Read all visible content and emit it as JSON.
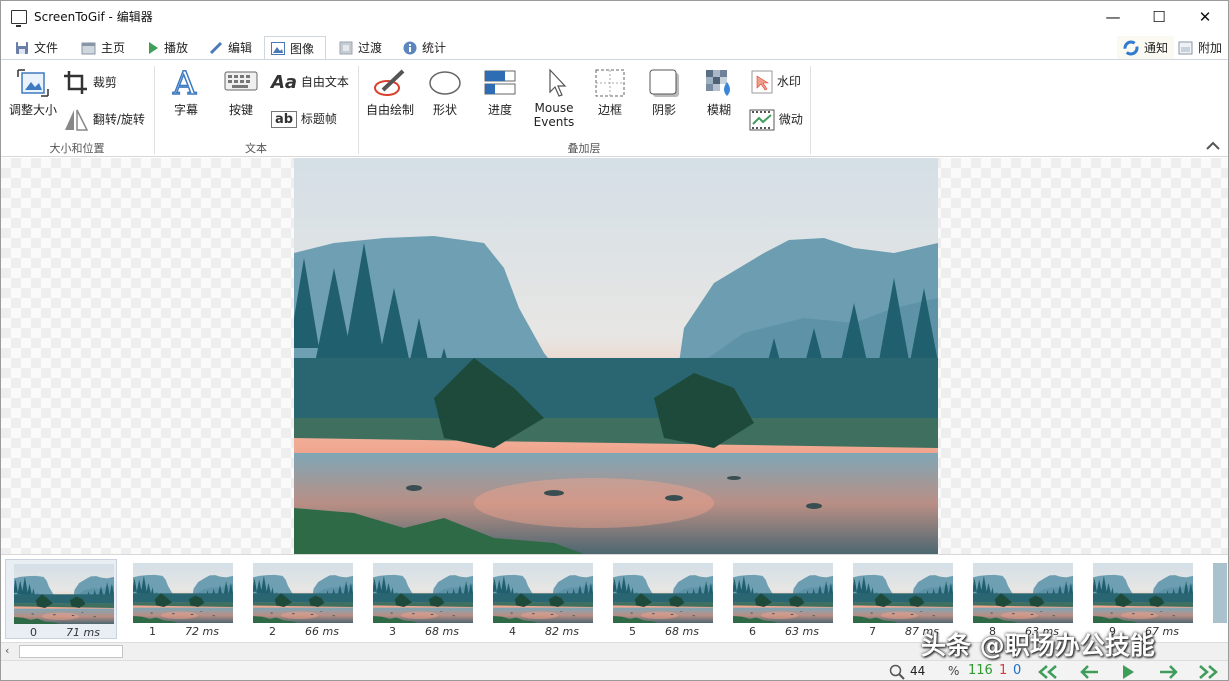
{
  "window": {
    "title": "ScreenToGif - 编辑器",
    "minimize": "—",
    "maximize": "☐",
    "close": "✕"
  },
  "tabs": [
    {
      "label": "文件",
      "icon": "save-icon"
    },
    {
      "label": "主页",
      "icon": "home-icon"
    },
    {
      "label": "播放",
      "icon": "play-icon"
    },
    {
      "label": "编辑",
      "icon": "pencil-icon"
    },
    {
      "label": "图像",
      "icon": "image-icon"
    },
    {
      "label": "过渡",
      "icon": "transition-icon"
    },
    {
      "label": "统计",
      "icon": "info-icon"
    }
  ],
  "active_tab": "图像",
  "notify": {
    "label": "通知"
  },
  "attach": {
    "label": "附加"
  },
  "ribbon": {
    "size_group": {
      "label": "大小和位置",
      "resize": "调整大小",
      "crop": "裁剪",
      "flip": "翻转/旋转"
    },
    "text_group": {
      "label": "文本",
      "caption": "字幕",
      "keys": "按键",
      "free_text": "自由文本",
      "title_frame": "标题帧"
    },
    "overlay_group": {
      "label": "叠加层",
      "free_drawing": "自由绘制",
      "shapes": "形状",
      "progress": "进度",
      "mouse_events_1": "Mouse",
      "mouse_events_2": "Events",
      "border": "边框",
      "shadow": "阴影",
      "obfuscate": "模糊",
      "watermark": "水印",
      "cinemagraph": "微动"
    }
  },
  "frames": [
    {
      "index": "0",
      "delay": "71 ms"
    },
    {
      "index": "1",
      "delay": "72 ms"
    },
    {
      "index": "2",
      "delay": "66 ms"
    },
    {
      "index": "3",
      "delay": "68 ms"
    },
    {
      "index": "4",
      "delay": "82 ms"
    },
    {
      "index": "5",
      "delay": "68 ms"
    },
    {
      "index": "6",
      "delay": "63 ms"
    },
    {
      "index": "7",
      "delay": "87 ms"
    },
    {
      "index": "8",
      "delay": "63 ms"
    },
    {
      "index": "9",
      "delay": "67 ms"
    }
  ],
  "status": {
    "zoom": "44",
    "percent": "%",
    "frame_count": "116",
    "selected_count": "1",
    "current_index": "0"
  },
  "overlay_watermark": "头条 @职场办公技能",
  "colors": {
    "accent": "#1a6fc9",
    "count_green": "#2e9b2e",
    "count_red": "#d83b3b",
    "count_blue": "#1a6fc9",
    "nav_green": "#3f9d5a"
  }
}
